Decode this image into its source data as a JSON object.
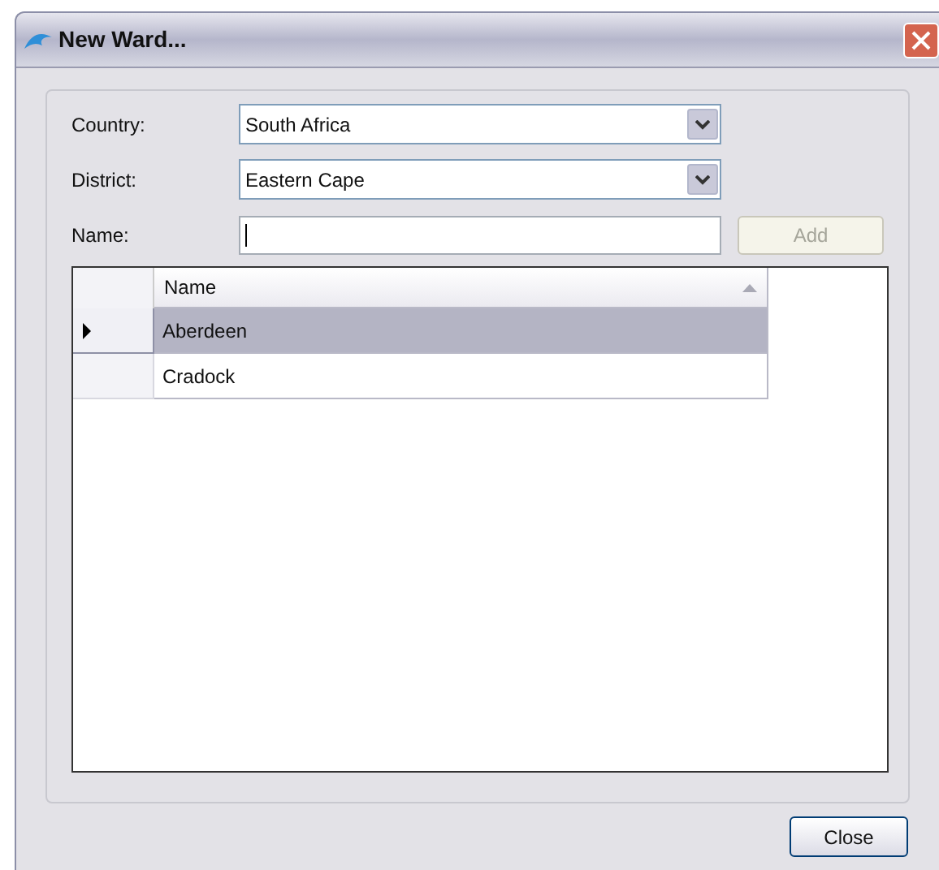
{
  "window": {
    "title": "New Ward..."
  },
  "fields": [
    {
      "kind": "combo",
      "label": "Country:",
      "value": "South Africa"
    },
    {
      "kind": "combo",
      "label": "District:",
      "value": "Eastern Cape"
    },
    {
      "kind": "text",
      "label": "Name:"
    }
  ],
  "add_button": {
    "label": "Add",
    "disabled": true
  },
  "table": {
    "columns": [
      "Name"
    ],
    "rows": [
      {
        "name": "Aberdeen",
        "selected": true
      },
      {
        "name": "Cradock",
        "selected": false
      }
    ]
  },
  "close_button": {
    "label": "Close"
  }
}
